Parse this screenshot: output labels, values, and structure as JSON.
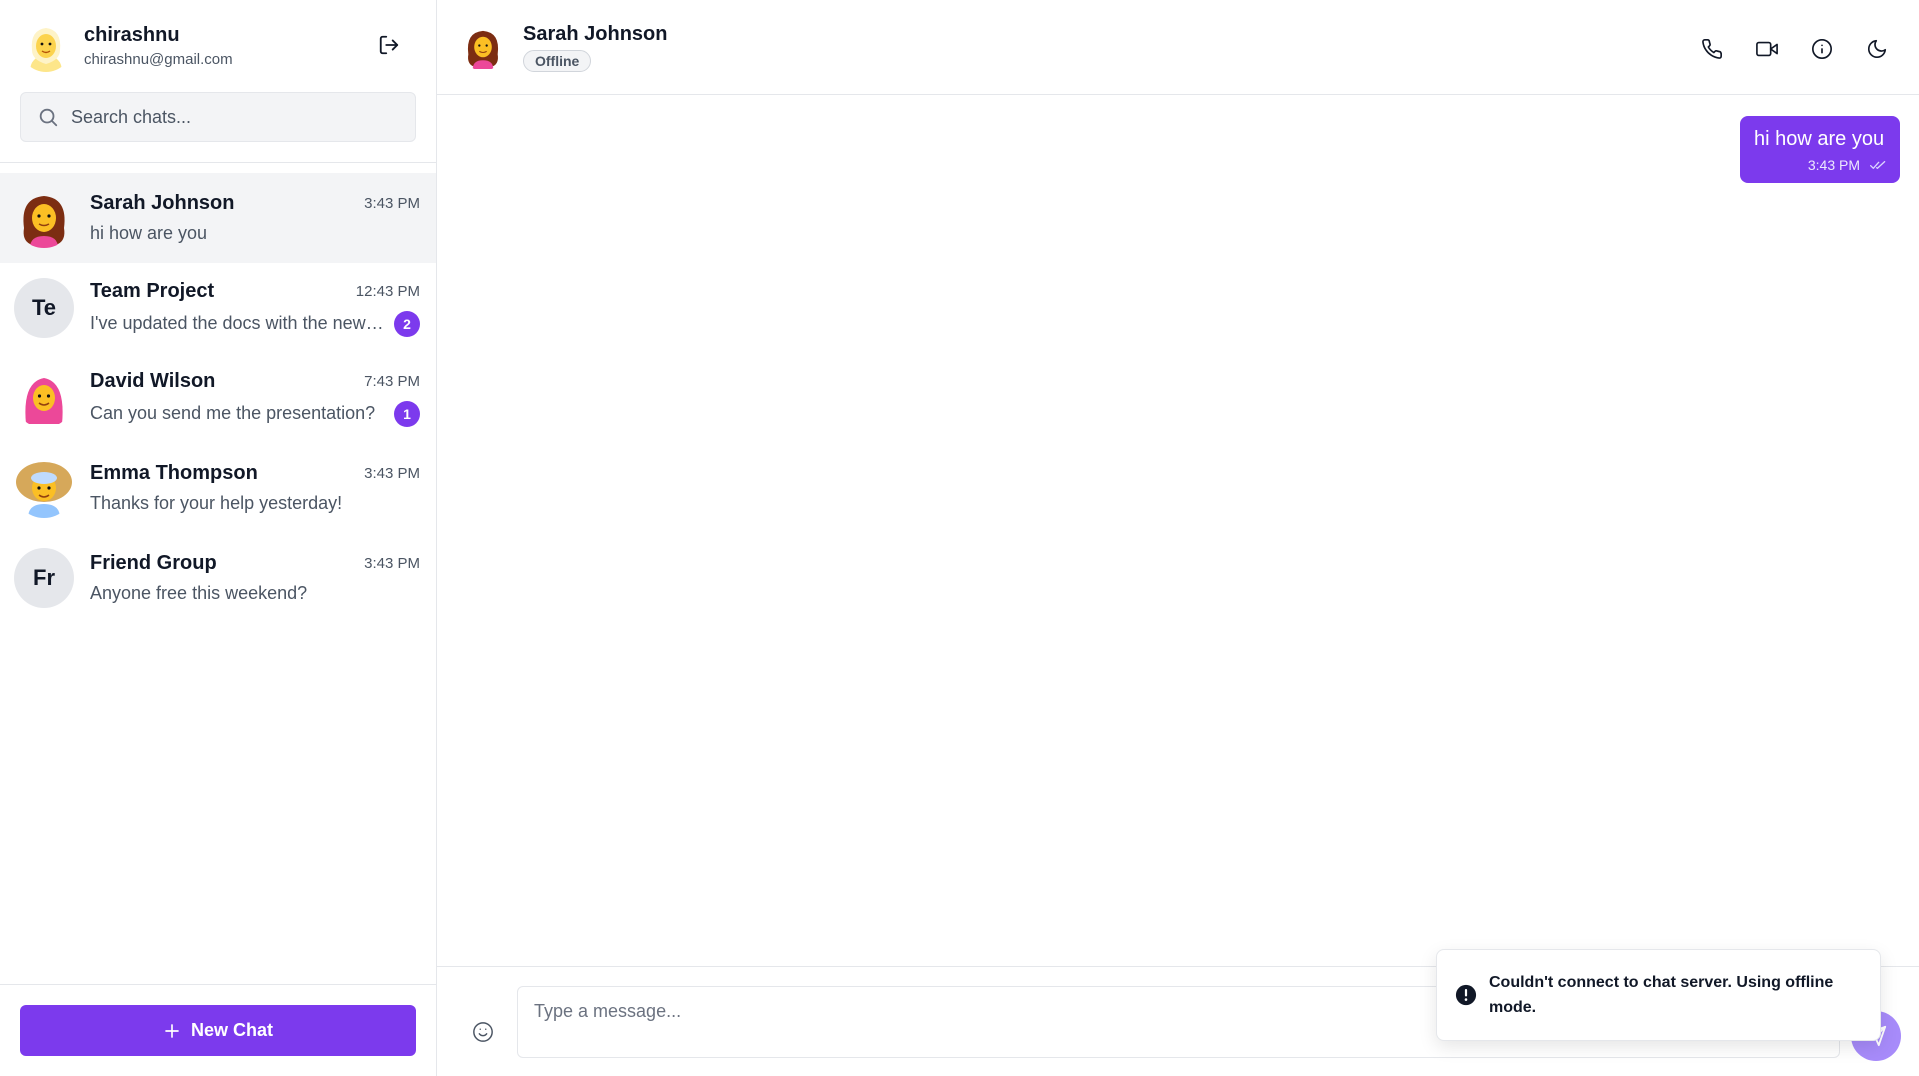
{
  "user": {
    "name": "chirashnu",
    "email": "chirashnu@gmail.com"
  },
  "search": {
    "placeholder": "Search chats..."
  },
  "chats": [
    {
      "name": "Sarah Johnson",
      "time": "3:43 PM",
      "preview": "hi how are you",
      "avatar": "sarah-avatar"
    },
    {
      "name": "Team Project",
      "time": "12:43 PM",
      "preview": "I've updated the docs with the new requirements",
      "initials": "Te",
      "badge": "2"
    },
    {
      "name": "David Wilson",
      "time": "7:43 PM",
      "preview": "Can you send me the presentation?",
      "avatar": "david-avatar",
      "badge": "1"
    },
    {
      "name": "Emma Thompson",
      "time": "3:43 PM",
      "preview": "Thanks for your help yesterday!",
      "avatar": "emma-avatar"
    },
    {
      "name": "Friend Group",
      "time": "3:43 PM",
      "preview": "Anyone free this weekend?",
      "initials": "Fr"
    }
  ],
  "sidebar_footer": {
    "new_chat_label": "New Chat"
  },
  "conversation": {
    "name": "Sarah Johnson",
    "status": "Offline",
    "messages": [
      {
        "text": "hi how are you",
        "time": "3:43 PM",
        "from": "me",
        "status_icon": "double-check-icon"
      }
    ]
  },
  "composer": {
    "placeholder": "Type a message..."
  },
  "toast": {
    "message": "Couldn't connect to chat server. Using offline mode."
  },
  "colors": {
    "accent": "#7c3aed",
    "accent_light": "#a78bfa",
    "active_row": "#f3f4f6"
  },
  "icons": {
    "logout": "logout-icon",
    "search": "search-icon",
    "phone": "phone-icon",
    "video": "video-icon",
    "info": "info-icon",
    "theme": "moon-icon",
    "emoji": "smile-icon",
    "send": "send-icon",
    "plus": "plus-icon",
    "toast": "alert-circle-icon"
  }
}
